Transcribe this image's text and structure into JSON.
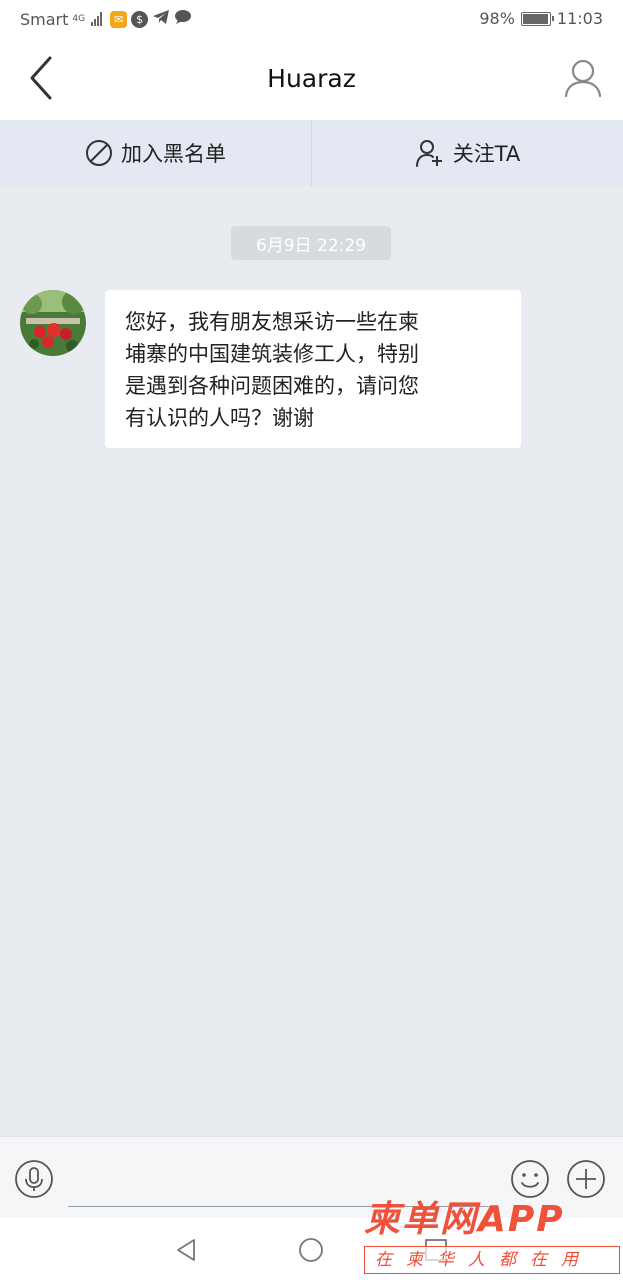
{
  "status_bar": {
    "carrier": "Smart",
    "network": "4G",
    "battery": "98%",
    "time": "11:03",
    "icons": [
      "mail-icon",
      "dollar-icon",
      "telegram-icon",
      "chat-icon"
    ]
  },
  "header": {
    "title": "Huaraz"
  },
  "actions": {
    "blacklist": "加入黑名单",
    "follow": "关注TA"
  },
  "chat": {
    "timestamp": "6月9日 22:29",
    "messages": [
      {
        "lines": [
          "您好，我有朋友想采访一些在柬",
          "埔寨的中国建筑装修工人，特别",
          "是遇到各种问题困难的，请问您",
          "有认识的人吗？谢谢"
        ]
      }
    ]
  },
  "input": {
    "placeholder": ""
  },
  "watermark": {
    "brand": "柬单网APP",
    "slogan": "在柬华人都在用"
  },
  "colors": {
    "background": "#e8ebf0",
    "action_bar": "#e3e8f3",
    "watermark": "#f0513a"
  }
}
